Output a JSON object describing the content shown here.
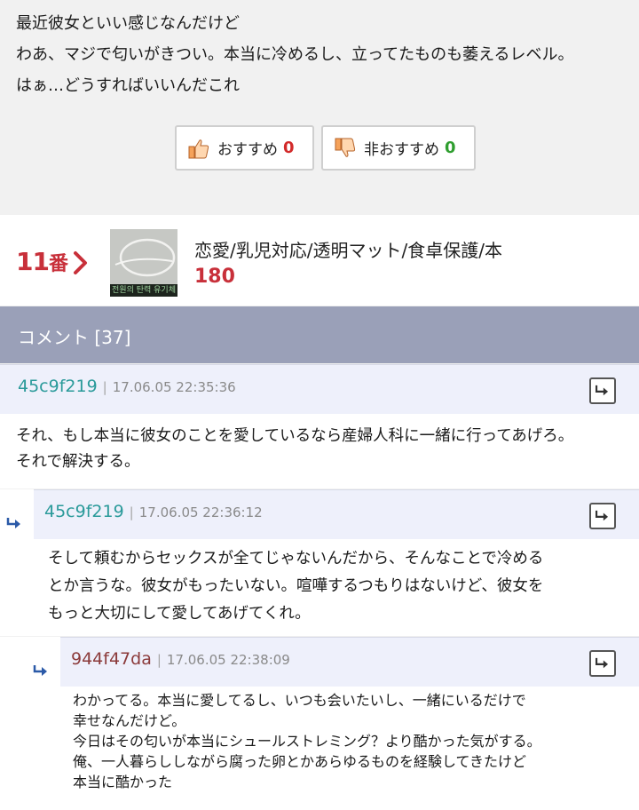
{
  "post": {
    "lines": [
      "最近彼女といい感じなんだけど",
      "わあ、マジで匂いがきつい。本当に冷めるし、立ってたものも萎えるレベル。",
      "はぁ…どうすればいいんだこれ"
    ]
  },
  "votes": {
    "recommend_label": "おすすめ",
    "recommend_count": "0",
    "recommend_color": "#d22a2a",
    "unrecommend_label": "非おすすめ",
    "unrecommend_count": "0",
    "unrecommend_color": "#2f9e2f"
  },
  "related_post": {
    "rank": "11",
    "rank_unit": "番",
    "thumbnail_caption": "전원의 탄력 유기체의",
    "title": "恋愛/乳児対応/透明マット/食卓保護/本",
    "count": "180"
  },
  "comments_section": {
    "title": "コメント [37]"
  },
  "comments": [
    {
      "author": "45c9f219",
      "author_color": "#2a9a9a",
      "separator": "|",
      "time": "17.06.05 22:35:36",
      "lines": [
        "それ、もし本当に彼女のことを愛しているなら産婦人科に一緒に行ってあげろ。",
        "それで解決する。"
      ]
    },
    {
      "author": "45c9f219",
      "author_color": "#2a9a9a",
      "separator": "|",
      "time": "17.06.05 22:36:12",
      "lines": [
        "そして頼むからセックスが全てじゃないんだから、そんなことで冷める",
        "とか言うな。彼女がもったいない。喧嘩するつもりはないけど、彼女を",
        "もっと大切にして愛してあげてくれ。"
      ]
    },
    {
      "author": "944f47da",
      "author_color": "#8b3a3a",
      "separator": "|",
      "time": "17.06.05 22:38:09",
      "lines": [
        "わかってる。本当に愛してるし、いつも会いたいし、一緒にいるだけで",
        "幸せなんだけど。",
        "今日はその匂いが本当にシュールストレミング？より酷かった気がする。",
        "俺、一人暮らししながら腐った卵とかあらゆるものを経験してきたけど",
        "本当に酷かった"
      ]
    }
  ]
}
